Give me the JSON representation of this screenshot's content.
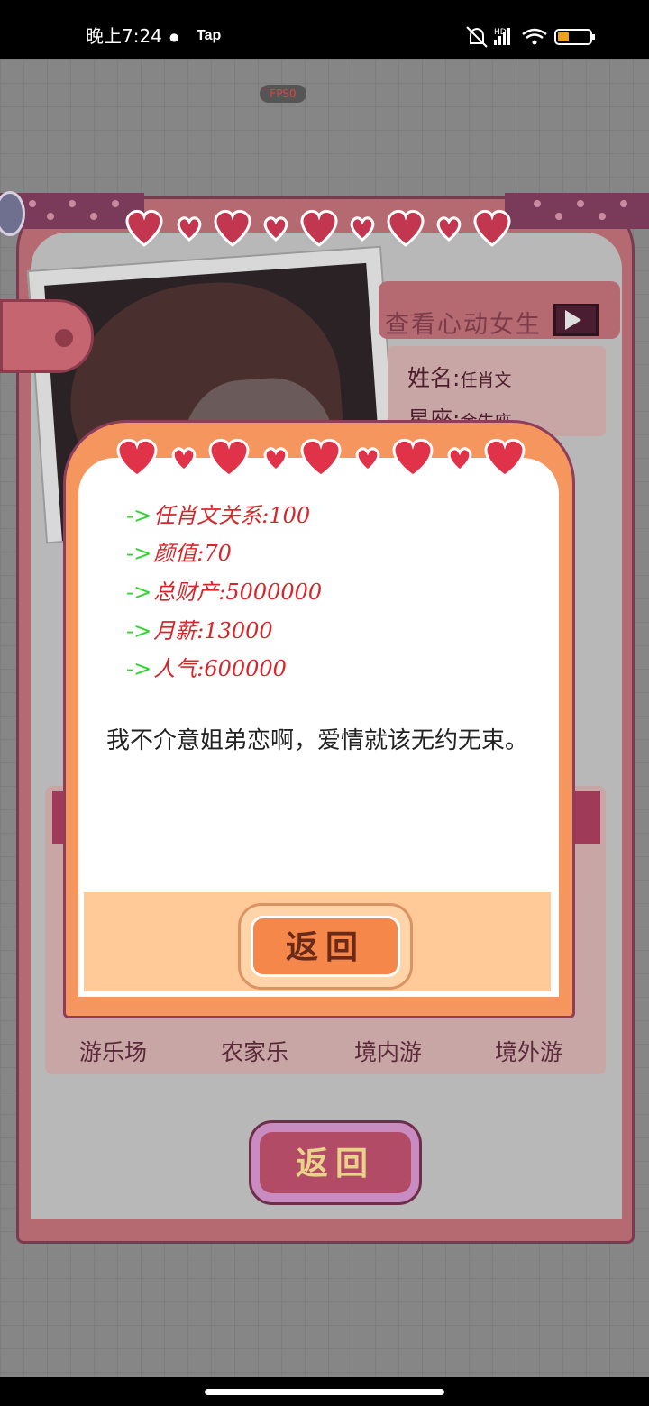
{
  "status_bar": {
    "time": "晚上7:24",
    "app_indicator": "Tap",
    "network": "HD",
    "battery_level": 0.3
  },
  "fps_label": "FPS0",
  "profile_card": {
    "view_label": "查看心动女生",
    "name_label": "姓名:",
    "name_value": "任肖文",
    "constellation_label": "星座:",
    "constellation_value": "金牛座",
    "activities": [
      "游乐场",
      "农家乐",
      "境内游",
      "境外游"
    ],
    "return_label": "返回"
  },
  "dialog": {
    "stats": [
      {
        "label": "任肖文关系",
        "value": "100"
      },
      {
        "label": "颜值",
        "value": "70"
      },
      {
        "label": "总财产",
        "value": "5000000"
      },
      {
        "label": "月薪",
        "value": "13000"
      },
      {
        "label": "人气",
        "value": "600000"
      }
    ],
    "stat_arrow": "->",
    "description": "我不介意姐弟恋啊，爱情就该无约无束。",
    "return_label": "返回"
  },
  "colors": {
    "heart_red": "#e0334a",
    "dialog_orange": "#f5965f",
    "card_pink": "#b56a72",
    "stat_text": "#d6262a",
    "stat_arrow": "#2fd52f"
  }
}
